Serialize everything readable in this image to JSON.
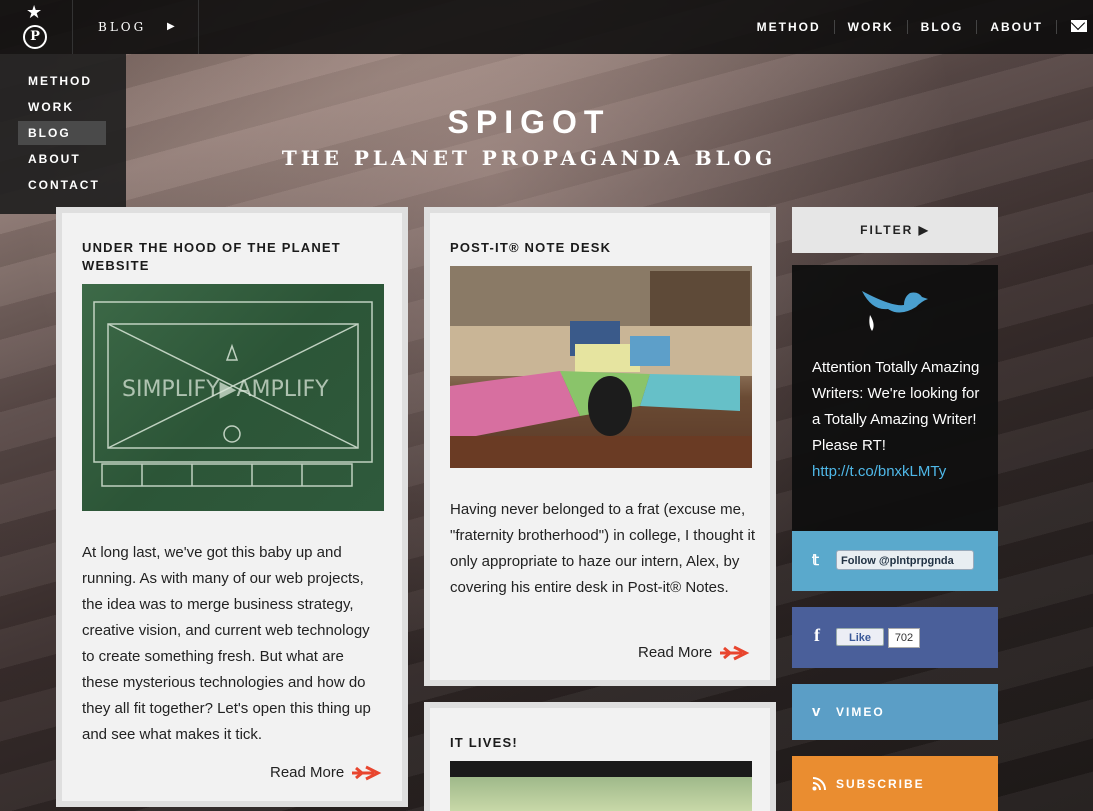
{
  "topbar": {
    "crumb": "BLOG",
    "nav": [
      "METHOD",
      "WORK",
      "BLOG",
      "ABOUT"
    ]
  },
  "sidenav": [
    "METHOD",
    "WORK",
    "BLOG",
    "ABOUT",
    "CONTACT"
  ],
  "hero": {
    "title": "SPIGOT",
    "subtitle": "THE PLANET PROPAGANDA BLOG"
  },
  "posts": [
    {
      "title": "UNDER THE HOOD OF THE PLANET WEBSITE",
      "body": "At long last, we've got this baby up and running. As with many of our web projects, the idea was to merge business strategy, creative vision, and current web technology to create something fresh. But what are these mysterious technologies and how do they all fit together? Let's open this thing up and see what makes it tick.",
      "more": "Read More"
    },
    {
      "title": "POST-IT® NOTE DESK",
      "body": "Having never belonged to a frat (excuse me, \"fraternity brotherhood\") in college, I thought it only appropriate to haze our intern, Alex, by covering his entire desk in Post-it® Notes.",
      "more": "Read More"
    },
    {
      "title": "IT LIVES!"
    }
  ],
  "sidebar": {
    "filter": "FILTER",
    "tweet_text": "Attention Totally Amazing Writers: We're looking for a Totally Amazing Writer! Please RT!",
    "tweet_link": "http://t.co/bnxkLMTy",
    "twitter_button": "Follow @plntprpgnda",
    "facebook_button": "Like",
    "facebook_count": "702",
    "vimeo": "VIMEO",
    "subscribe": "SUBSCRIBE"
  },
  "colors": {
    "accent": "#e8452e",
    "twitter": "#5aa9cc",
    "facebook": "#4a5f9a",
    "vimeo": "#5b9ec6",
    "subscribe": "#ea8d30"
  },
  "icons": [
    "star-icon",
    "planet-logo-icon",
    "mail-icon",
    "bird-icon",
    "twitter-icon",
    "facebook-icon",
    "vimeo-icon",
    "rss-icon",
    "arrow-icon"
  ]
}
